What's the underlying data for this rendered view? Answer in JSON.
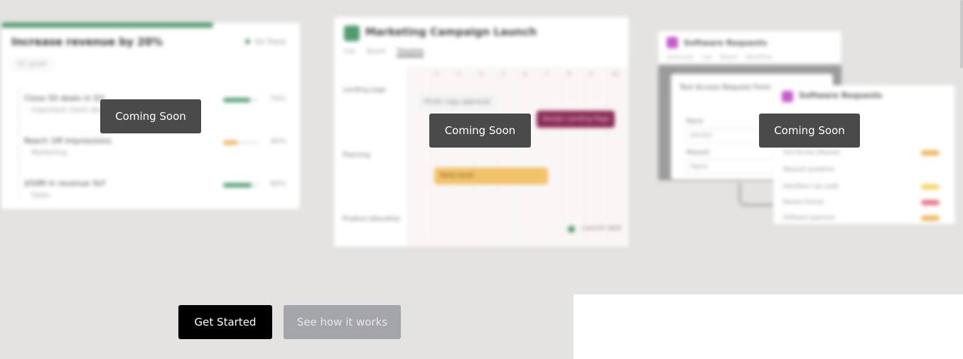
{
  "overlays": {
    "coming_soon": [
      "Coming Soon",
      "Coming Soon",
      "Coming Soon"
    ]
  },
  "cta": {
    "get_started": "Get Started",
    "see_how": "See how it works"
  },
  "colors": {
    "page_bg": "#e4e3e1",
    "overlay_bg": "#4a4a4a",
    "primary_button": "#000000",
    "secondary_button": "#a4a5ab",
    "green_accent": "#4f9b6f",
    "purple_accent": "#c55bc9"
  },
  "goals_card": {
    "title": "Increase revenue by 20%",
    "status": "On Track",
    "chip": "Q3 goals",
    "rows": [
      {
        "name": "Close 50 deals in Q3",
        "sub": "Important client deals",
        "progress": 0.76,
        "pct": "76%",
        "color": "#4f9b6f"
      },
      {
        "name": "Reach 1M impressions",
        "sub": "Marketing",
        "progress": 0.4,
        "pct": "40%",
        "color": "#f0b251"
      },
      {
        "name": "$50M in revenue YoY",
        "sub": "Sales",
        "progress": 0.8,
        "pct": "80%",
        "color": "#4f9b6f"
      }
    ]
  },
  "campaign_card": {
    "title": "Marketing Campaign Launch",
    "tabs": [
      "List",
      "Board",
      "Timeline"
    ],
    "days": [
      "2",
      "3",
      "4",
      "5",
      "6",
      "7",
      "8",
      "9",
      "10"
    ],
    "lanes": [
      "Landing page",
      "Planning",
      "Product education"
    ],
    "tasks": [
      "Finish copy approval",
      "Design Landing Page",
      "Write brief"
    ],
    "milestone": "Launch date"
  },
  "requests_card": {
    "title": "Software Requests",
    "tabs": [
      "Overview",
      "List",
      "Board",
      "Workflow"
    ],
    "form_title": "Tool Access Request Form",
    "form_fields": [
      {
        "label": "Name",
        "value": "Isla Kim"
      },
      {
        "label": "Request",
        "value": "Figma"
      }
    ],
    "front_title": "Software Requests",
    "front_rows": [
      "Tool Access Request",
      "Request guideline",
      "Workflow rule audit",
      "Renew license",
      "Software approval"
    ]
  }
}
